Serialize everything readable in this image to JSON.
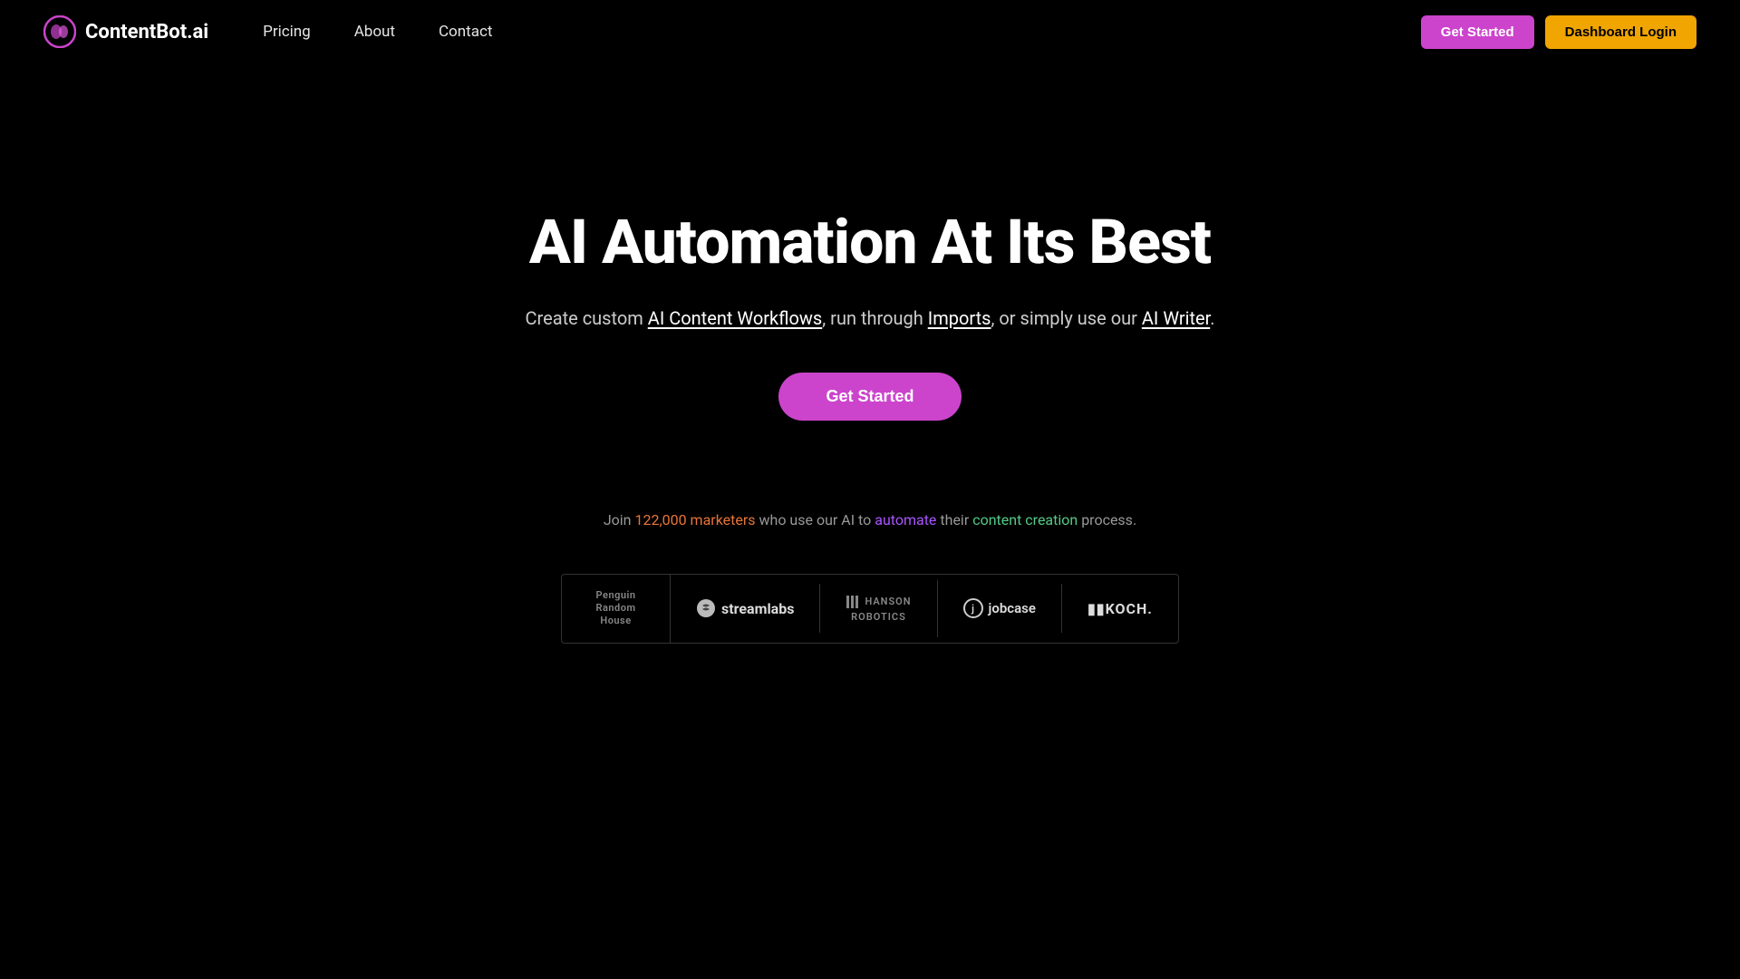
{
  "nav": {
    "logo_text": "ContentBot.ai",
    "links": [
      {
        "label": "Pricing",
        "href": "#"
      },
      {
        "label": "About",
        "href": "#"
      },
      {
        "label": "Contact",
        "href": "#"
      }
    ],
    "btn_get_started": "Get Started",
    "btn_dashboard_login": "Dashboard Login"
  },
  "hero": {
    "title": "AI Automation At Its Best",
    "subtitle_before": "Create custom ",
    "subtitle_link1": "AI Content Workflows",
    "subtitle_mid1": ", run through ",
    "subtitle_link2": "Imports",
    "subtitle_mid2": ", or simply use our ",
    "subtitle_link3": "AI Writer",
    "subtitle_after": ".",
    "btn_get_started": "Get Started"
  },
  "social_proof": {
    "text_before": "Join ",
    "highlight1": "122,000 marketers",
    "text_mid1": " who use our AI to ",
    "highlight2": "automate",
    "text_mid2": " their ",
    "highlight3": "content creation",
    "text_after": " process."
  },
  "logos": [
    {
      "id": "penguin",
      "line1": "Penguin",
      "line2": "Random",
      "line3": "House"
    },
    {
      "id": "streamlabs",
      "text": "streamlabs"
    },
    {
      "id": "hanson",
      "line1": "HANSON",
      "line2": "ROBOTICS"
    },
    {
      "id": "jobcase",
      "text": "jobcase"
    },
    {
      "id": "koch",
      "text": "KKOCH."
    }
  ]
}
